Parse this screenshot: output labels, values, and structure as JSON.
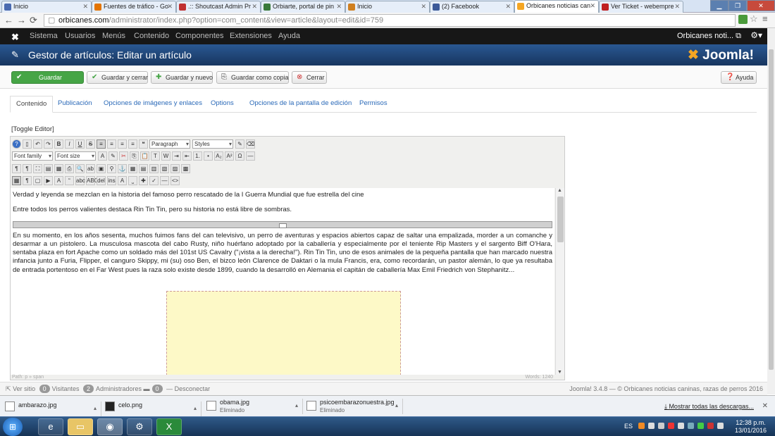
{
  "browser": {
    "tabs": [
      {
        "label": "Inicio",
        "color": "#4a6ab0"
      },
      {
        "label": "Fuentes de tráfico - Go",
        "color": "#e37400"
      },
      {
        "label": ".:: Shoutcast Admin Pr",
        "color": "#c03030"
      },
      {
        "label": "Orbiarte, portal de pin",
        "color": "#3a7a3a"
      },
      {
        "label": "Inicio",
        "color": "#d08020"
      },
      {
        "label": "(2) Facebook",
        "color": "#3b5998"
      },
      {
        "label": "Orbicanes noticias can",
        "color": "#f5a623"
      },
      {
        "label": "Ver Ticket - webempre",
        "color": "#c02020"
      }
    ],
    "url_host": "orbicanes.com",
    "url_path": "/administrator/index.php?option=com_content&view=article&layout=edit&id=759"
  },
  "joomla": {
    "menu": [
      "Sistema",
      "Usuarios",
      "Menús",
      "Contenido",
      "Componentes",
      "Extensiones",
      "Ayuda"
    ],
    "site_name": "Orbicanes noti...",
    "page_title": "Gestor de artículos: Editar un artículo",
    "brand": "Joomla!",
    "toolbar": {
      "save": "Guardar",
      "save_close": "Guardar y cerrar",
      "save_new": "Guardar y nuevo",
      "save_copy": "Guardar como copia",
      "close": "Cerrar",
      "help": "Ayuda"
    },
    "tabs": [
      "Contenido",
      "Publicación",
      "Opciones de imágenes y enlaces",
      "Options",
      "Opciones de la pantalla de edición",
      "Permisos"
    ],
    "toggle_editor": "[Toggle Editor]"
  },
  "editor": {
    "format_select": "Paragraph",
    "styles_select": "Styles",
    "font_family": "Font family",
    "font_size": "Font size",
    "paragraph1": "Verdad y leyenda se mezclan en la historia del famoso perro rescatado de la I Guerra Mundial que fue estrella del cine",
    "paragraph2": "Entre todos los perros valientes destaca Rin Tin Tin, pero su historia no está libre de sombras.",
    "paragraph3": "En su momento, en los años sesenta, muchos fuimos fans del can televisivo, un perro de aventuras y espacios abiertos capaz de saltar una empalizada, morder a un comanche y desarmar a un pistolero. La musculosa mascota del cabo Rusty, niño huérfano adoptado por la caballería y especialmente por el teniente Rip Masters y el sargento Biff O'Hara, sentaba plaza en fort Apache como un soldado más del 101st US Cavalry (\"¡vista a la derecha!\"). Rin Tin Tin, uno de esos animales de la pequeña pantalla que han marcado nuestra infancia junto a Furia, Flipper, el canguro Skippy, mi (su) oso Ben, el bizco león Clarence de Daktari o la mula Francis, era, como recordarán, un pastor alemán, lo que ya resultaba de entrada portentoso en el Far West pues la raza solo existe desde 1899, cuando la desarrolló en Alemania el capitán de caballería Max Emil Friedrich von Stephanitz...",
    "path": "Path: p » span",
    "words": "Words: 1240"
  },
  "footer": {
    "view_site": "Ver sitio",
    "visitors_count": "0",
    "visitors": "Visitantes",
    "admins_count": "2",
    "admins": "Administradores",
    "logout_count": "0",
    "logout": "Desconectar",
    "version": "Joomla! 3.4.8 — © Orbicanes noticias caninas, razas de perros 2016"
  },
  "downloads": {
    "items": [
      {
        "name": "ambarazo.jpg",
        "status": ""
      },
      {
        "name": "celo.png",
        "status": ""
      },
      {
        "name": "obama.jpg",
        "status": "Eliminado"
      },
      {
        "name": "psicoembarazonuestra.jpg",
        "status": "Eliminado"
      }
    ],
    "show_all": "Mostrar todas las descargas..."
  },
  "taskbar": {
    "lang": "ES",
    "time": "12:38 p.m.",
    "date": "13/01/2016"
  }
}
